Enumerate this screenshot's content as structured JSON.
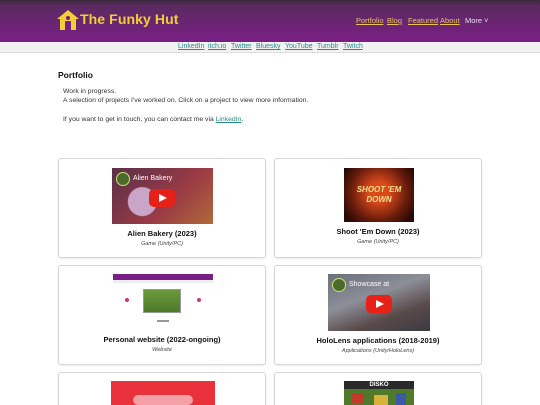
{
  "header": {
    "site_title": "The Funky Hut",
    "nav": [
      {
        "label": "Portfolio"
      },
      {
        "label": "Blog"
      },
      {
        "label": "Featured"
      },
      {
        "label": "About"
      },
      {
        "label": "More ˅"
      }
    ]
  },
  "social_links": [
    {
      "label": "LinkedIn"
    },
    {
      "label": "itch.io"
    },
    {
      "label": "Twitter"
    },
    {
      "label": "Bluesky"
    },
    {
      "label": "YouTube"
    },
    {
      "label": "Tumblr"
    },
    {
      "label": "Twitch"
    }
  ],
  "page": {
    "title": "Portfolio",
    "intro_line1": "Work in progress.",
    "intro_line2": "A selection of projects I've worked on. Click on a project to view more information.",
    "contact_prefix": "If you want to get in touch, you can contact me via ",
    "contact_link": "LinkedIn",
    "contact_suffix": "."
  },
  "projects": [
    {
      "title": "Alien Bakery (2023)",
      "subtitle": "Game (Unity/PC)",
      "video_caption": "Alien Bakery"
    },
    {
      "title": "Shoot 'Em Down (2023)",
      "subtitle": "Game (Unity/PC)",
      "thumb_text_1": "SHOOT 'EM",
      "thumb_text_2": "DOWN"
    },
    {
      "title": "Personal website (2022-ongoing)",
      "subtitle": "Website"
    },
    {
      "title": "HoloLens applications (2018-2019)",
      "subtitle": "Applications (Unity/HoloLens)",
      "video_caption": "Showcase at"
    },
    {
      "thumb_text": "DISKO"
    }
  ],
  "colors": {
    "header_bg": "#7a1f86",
    "title_yellow": "#f2d034",
    "link_teal": "#2a8a8a",
    "youtube_red": "#e62117"
  }
}
